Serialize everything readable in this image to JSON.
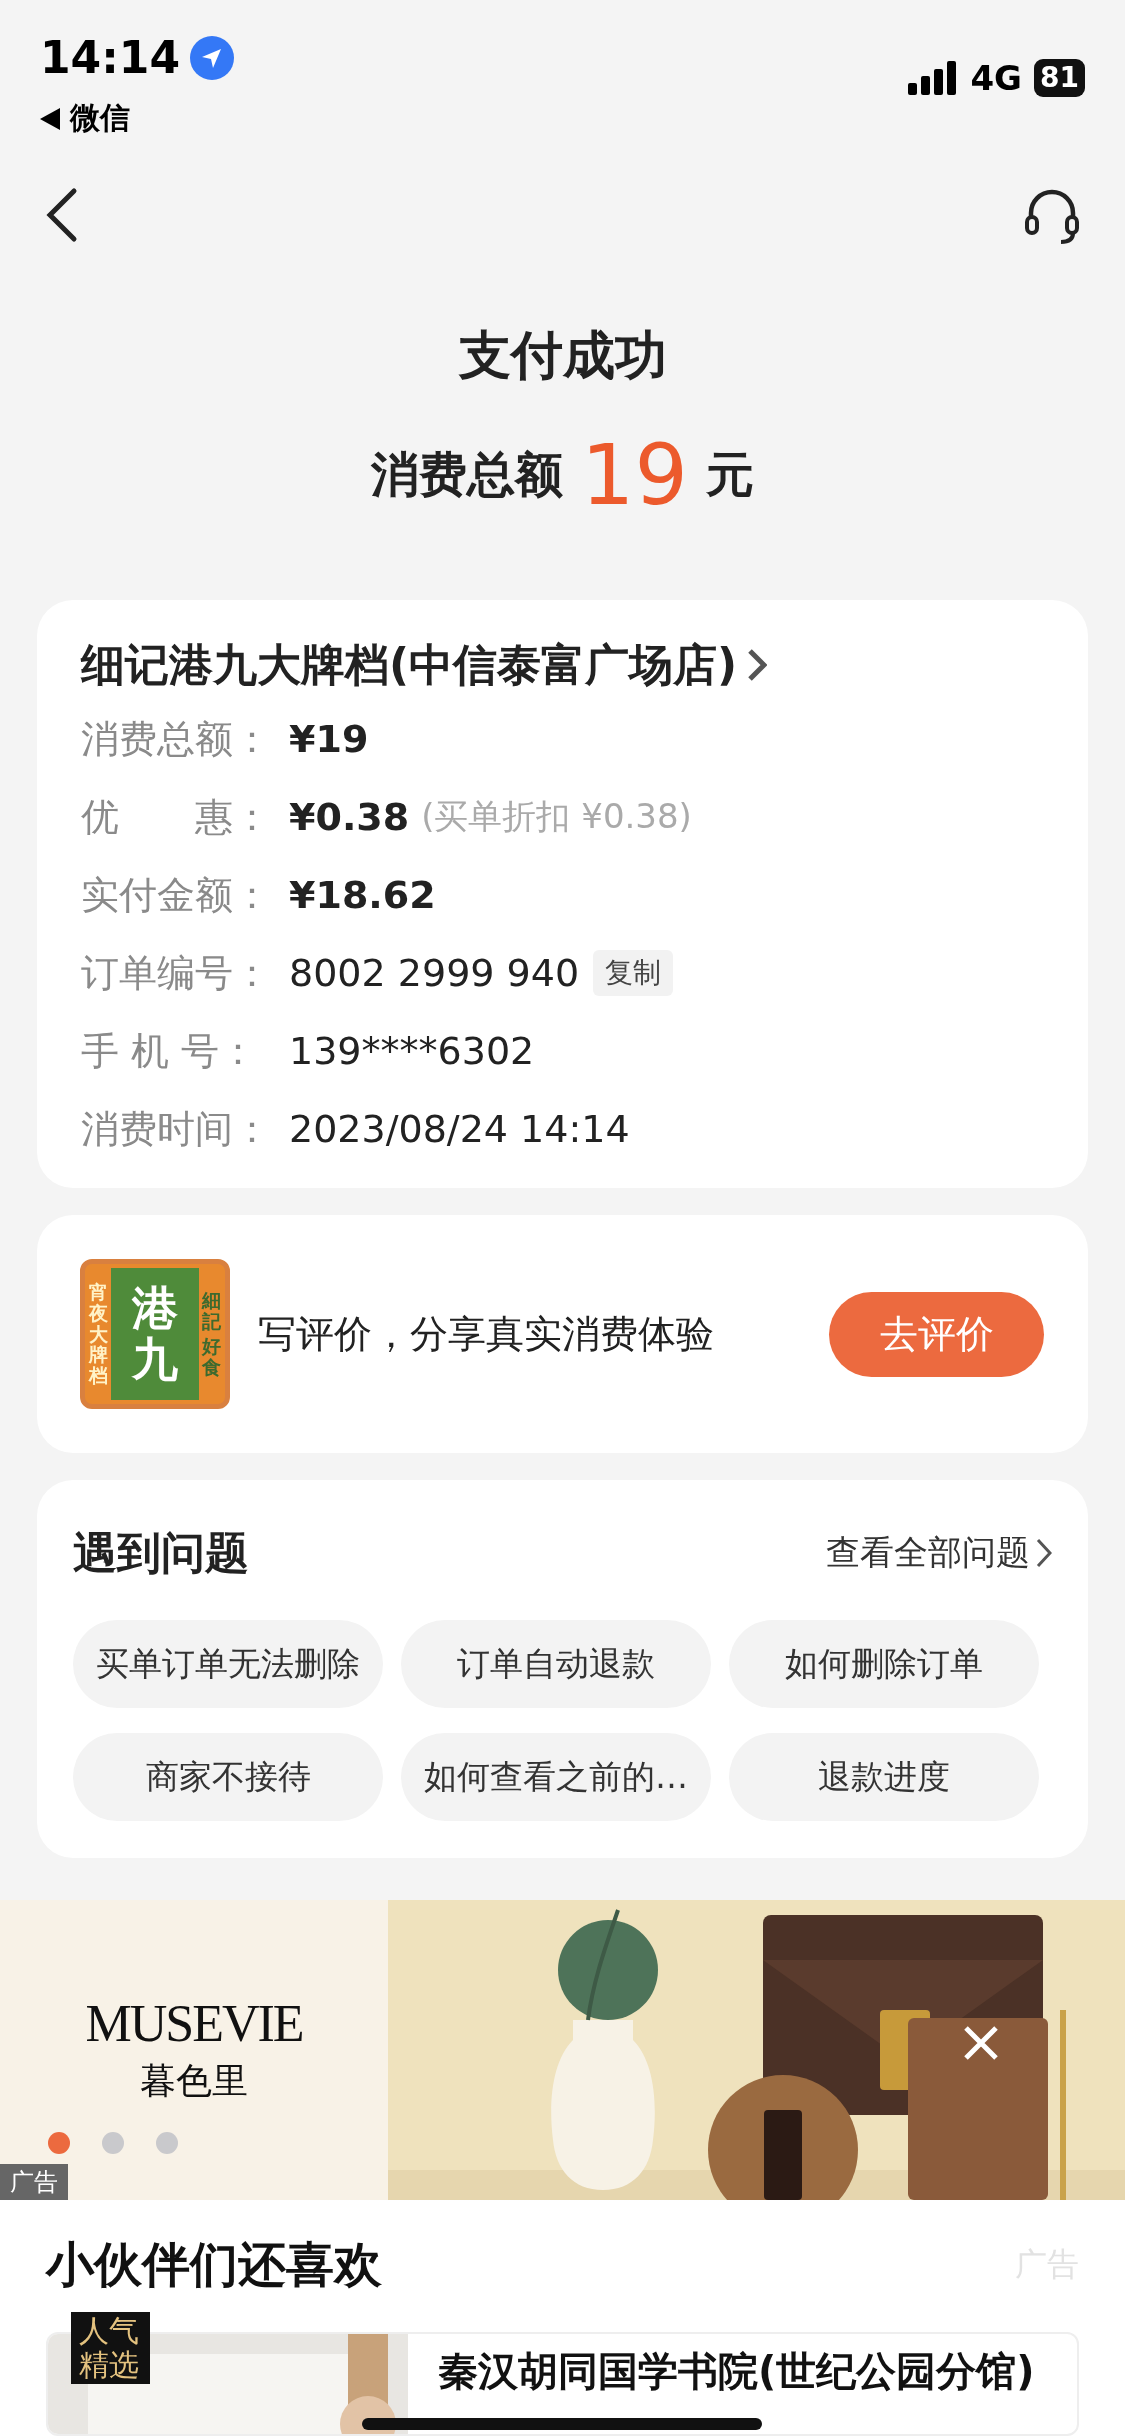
{
  "status_bar": {
    "time": "14:14",
    "back_app": "微信",
    "network": "4G",
    "battery": "81"
  },
  "header": {
    "title": "支付成功",
    "total_label": "消费总额",
    "total_amount": "19",
    "total_unit": "元"
  },
  "order": {
    "store": "细记港九大牌档(中信泰富广场店)",
    "rows": [
      {
        "kind": "amount",
        "label": "消费总额：",
        "value": "¥19"
      },
      {
        "kind": "amount",
        "label": "优　　惠：",
        "value": "¥0.38",
        "note": "(买单折扣 ¥0.38)"
      },
      {
        "kind": "amount",
        "label": "实付金额：",
        "value": "¥18.62"
      },
      {
        "kind": "plain",
        "label": "订单编号：",
        "value": "8002 2999 940",
        "action": "复制"
      },
      {
        "kind": "plain",
        "label": "手 机 号：",
        "value": "139****6302"
      },
      {
        "kind": "plain",
        "label": "消费时间：",
        "value": "2023/08/24 14:14"
      }
    ]
  },
  "review": {
    "logo": {
      "main": "港九",
      "side": "宵夜大牌档",
      "seal": "細記",
      "tag": "好食"
    },
    "prompt": "写评价，分享真实消费体验",
    "button": "去评价"
  },
  "problems": {
    "title": "遇到问题",
    "link": "查看全部问题",
    "chips": [
      "买单订单无法删除",
      "订单自动退款",
      "如何删除订单",
      "商家不接待",
      "如何查看之前的…",
      "退款进度"
    ]
  },
  "ad_banner": {
    "brand": "MUSEVIE",
    "brand_cn": "暮色里",
    "tag": "广告",
    "slides": [
      {
        "selected": true
      },
      {
        "selected": false
      },
      {
        "selected": false
      }
    ]
  },
  "recommend": {
    "title": "小伙伴们还喜欢",
    "ad_tag": "广告",
    "items": [
      {
        "badge": "人气精选",
        "title": "秦汉胡同国学书院(世纪公园分馆)"
      }
    ]
  }
}
